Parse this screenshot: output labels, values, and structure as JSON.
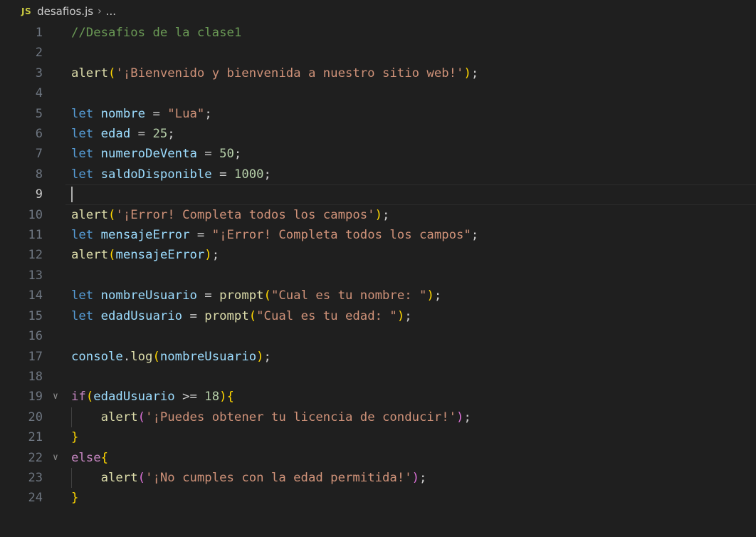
{
  "breadcrumb": {
    "icon_label": "JS",
    "filename": "desafios.js",
    "separator": "›",
    "ellipsis": "..."
  },
  "colors": {
    "background": "#1f1f1f",
    "comment": "#6a9955",
    "keyword": "#569cd6",
    "control": "#c586c0",
    "function": "#dcdcaa",
    "string": "#ce9178",
    "number": "#b5cea8",
    "variable": "#9cdcfe",
    "bracket_level1": "#ffd700",
    "bracket_level2": "#da70d6"
  },
  "editor": {
    "current_line": 9,
    "lines": [
      {
        "n": "1",
        "tokens": [
          {
            "t": "//Desafios de la clase1",
            "c": "comment"
          }
        ]
      },
      {
        "n": "2",
        "tokens": []
      },
      {
        "n": "3",
        "tokens": [
          {
            "t": "alert",
            "c": "func"
          },
          {
            "t": "(",
            "c": "b1"
          },
          {
            "t": "'¡Bienvenido y bienvenida a nuestro sitio web!'",
            "c": "str"
          },
          {
            "t": ")",
            "c": "b1"
          },
          {
            "t": ";",
            "c": "plain"
          }
        ]
      },
      {
        "n": "4",
        "tokens": []
      },
      {
        "n": "5",
        "tokens": [
          {
            "t": "let",
            "c": "keyword"
          },
          {
            "t": " ",
            "c": "plain"
          },
          {
            "t": "nombre",
            "c": "var"
          },
          {
            "t": " = ",
            "c": "plain"
          },
          {
            "t": "\"Lua\"",
            "c": "str"
          },
          {
            "t": ";",
            "c": "plain"
          }
        ]
      },
      {
        "n": "6",
        "tokens": [
          {
            "t": "let",
            "c": "keyword"
          },
          {
            "t": " ",
            "c": "plain"
          },
          {
            "t": "edad",
            "c": "var"
          },
          {
            "t": " = ",
            "c": "plain"
          },
          {
            "t": "25",
            "c": "num"
          },
          {
            "t": ";",
            "c": "plain"
          }
        ]
      },
      {
        "n": "7",
        "tokens": [
          {
            "t": "let",
            "c": "keyword"
          },
          {
            "t": " ",
            "c": "plain"
          },
          {
            "t": "numeroDeVenta",
            "c": "var"
          },
          {
            "t": " = ",
            "c": "plain"
          },
          {
            "t": "50",
            "c": "num"
          },
          {
            "t": ";",
            "c": "plain"
          }
        ]
      },
      {
        "n": "8",
        "tokens": [
          {
            "t": "let",
            "c": "keyword"
          },
          {
            "t": " ",
            "c": "plain"
          },
          {
            "t": "saldoDisponible",
            "c": "var"
          },
          {
            "t": " = ",
            "c": "plain"
          },
          {
            "t": "1000",
            "c": "num"
          },
          {
            "t": ";",
            "c": "plain"
          }
        ]
      },
      {
        "n": "9",
        "tokens": []
      },
      {
        "n": "10",
        "tokens": [
          {
            "t": "alert",
            "c": "func"
          },
          {
            "t": "(",
            "c": "b1"
          },
          {
            "t": "'¡Error! Completa todos los campos'",
            "c": "str"
          },
          {
            "t": ")",
            "c": "b1"
          },
          {
            "t": ";",
            "c": "plain"
          }
        ]
      },
      {
        "n": "11",
        "tokens": [
          {
            "t": "let",
            "c": "keyword"
          },
          {
            "t": " ",
            "c": "plain"
          },
          {
            "t": "mensajeError",
            "c": "var"
          },
          {
            "t": " = ",
            "c": "plain"
          },
          {
            "t": "\"¡Error! Completa todos los campos\"",
            "c": "str"
          },
          {
            "t": ";",
            "c": "plain"
          }
        ]
      },
      {
        "n": "12",
        "tokens": [
          {
            "t": "alert",
            "c": "func"
          },
          {
            "t": "(",
            "c": "b1"
          },
          {
            "t": "mensajeError",
            "c": "var"
          },
          {
            "t": ")",
            "c": "b1"
          },
          {
            "t": ";",
            "c": "plain"
          }
        ]
      },
      {
        "n": "13",
        "tokens": []
      },
      {
        "n": "14",
        "tokens": [
          {
            "t": "let",
            "c": "keyword"
          },
          {
            "t": " ",
            "c": "plain"
          },
          {
            "t": "nombreUsuario",
            "c": "var"
          },
          {
            "t": " = ",
            "c": "plain"
          },
          {
            "t": "prompt",
            "c": "func"
          },
          {
            "t": "(",
            "c": "b1"
          },
          {
            "t": "\"Cual es tu nombre: \"",
            "c": "str"
          },
          {
            "t": ")",
            "c": "b1"
          },
          {
            "t": ";",
            "c": "plain"
          }
        ]
      },
      {
        "n": "15",
        "tokens": [
          {
            "t": "let",
            "c": "keyword"
          },
          {
            "t": " ",
            "c": "plain"
          },
          {
            "t": "edadUsuario",
            "c": "var"
          },
          {
            "t": " = ",
            "c": "plain"
          },
          {
            "t": "prompt",
            "c": "func"
          },
          {
            "t": "(",
            "c": "b1"
          },
          {
            "t": "\"Cual es tu edad: \"",
            "c": "str"
          },
          {
            "t": ")",
            "c": "b1"
          },
          {
            "t": ";",
            "c": "plain"
          }
        ]
      },
      {
        "n": "16",
        "tokens": []
      },
      {
        "n": "17",
        "tokens": [
          {
            "t": "console",
            "c": "var"
          },
          {
            "t": ".",
            "c": "plain"
          },
          {
            "t": "log",
            "c": "func"
          },
          {
            "t": "(",
            "c": "b1"
          },
          {
            "t": "nombreUsuario",
            "c": "var"
          },
          {
            "t": ")",
            "c": "b1"
          },
          {
            "t": ";",
            "c": "plain"
          }
        ]
      },
      {
        "n": "18",
        "tokens": []
      },
      {
        "n": "19",
        "fold": true,
        "tokens": [
          {
            "t": "if",
            "c": "control"
          },
          {
            "t": "(",
            "c": "b1"
          },
          {
            "t": "edadUsuario",
            "c": "var"
          },
          {
            "t": " >= ",
            "c": "plain"
          },
          {
            "t": "18",
            "c": "num"
          },
          {
            "t": ")",
            "c": "b1"
          },
          {
            "t": "{",
            "c": "b1"
          }
        ]
      },
      {
        "n": "20",
        "guide": true,
        "tokens": [
          {
            "t": "    ",
            "c": "plain"
          },
          {
            "t": "alert",
            "c": "func"
          },
          {
            "t": "(",
            "c": "b2"
          },
          {
            "t": "'¡Puedes obtener tu licencia de conducir!'",
            "c": "str"
          },
          {
            "t": ")",
            "c": "b2"
          },
          {
            "t": ";",
            "c": "plain"
          }
        ]
      },
      {
        "n": "21",
        "tokens": [
          {
            "t": "}",
            "c": "b1"
          }
        ]
      },
      {
        "n": "22",
        "fold": true,
        "tokens": [
          {
            "t": "else",
            "c": "control"
          },
          {
            "t": "{",
            "c": "b1"
          }
        ]
      },
      {
        "n": "23",
        "guide": true,
        "tokens": [
          {
            "t": "    ",
            "c": "plain"
          },
          {
            "t": "alert",
            "c": "func"
          },
          {
            "t": "(",
            "c": "b2"
          },
          {
            "t": "'¡No cumples con la edad permitida!'",
            "c": "str"
          },
          {
            "t": ")",
            "c": "b2"
          },
          {
            "t": ";",
            "c": "plain"
          }
        ]
      },
      {
        "n": "24",
        "tokens": [
          {
            "t": "}",
            "c": "b1"
          }
        ]
      }
    ]
  }
}
